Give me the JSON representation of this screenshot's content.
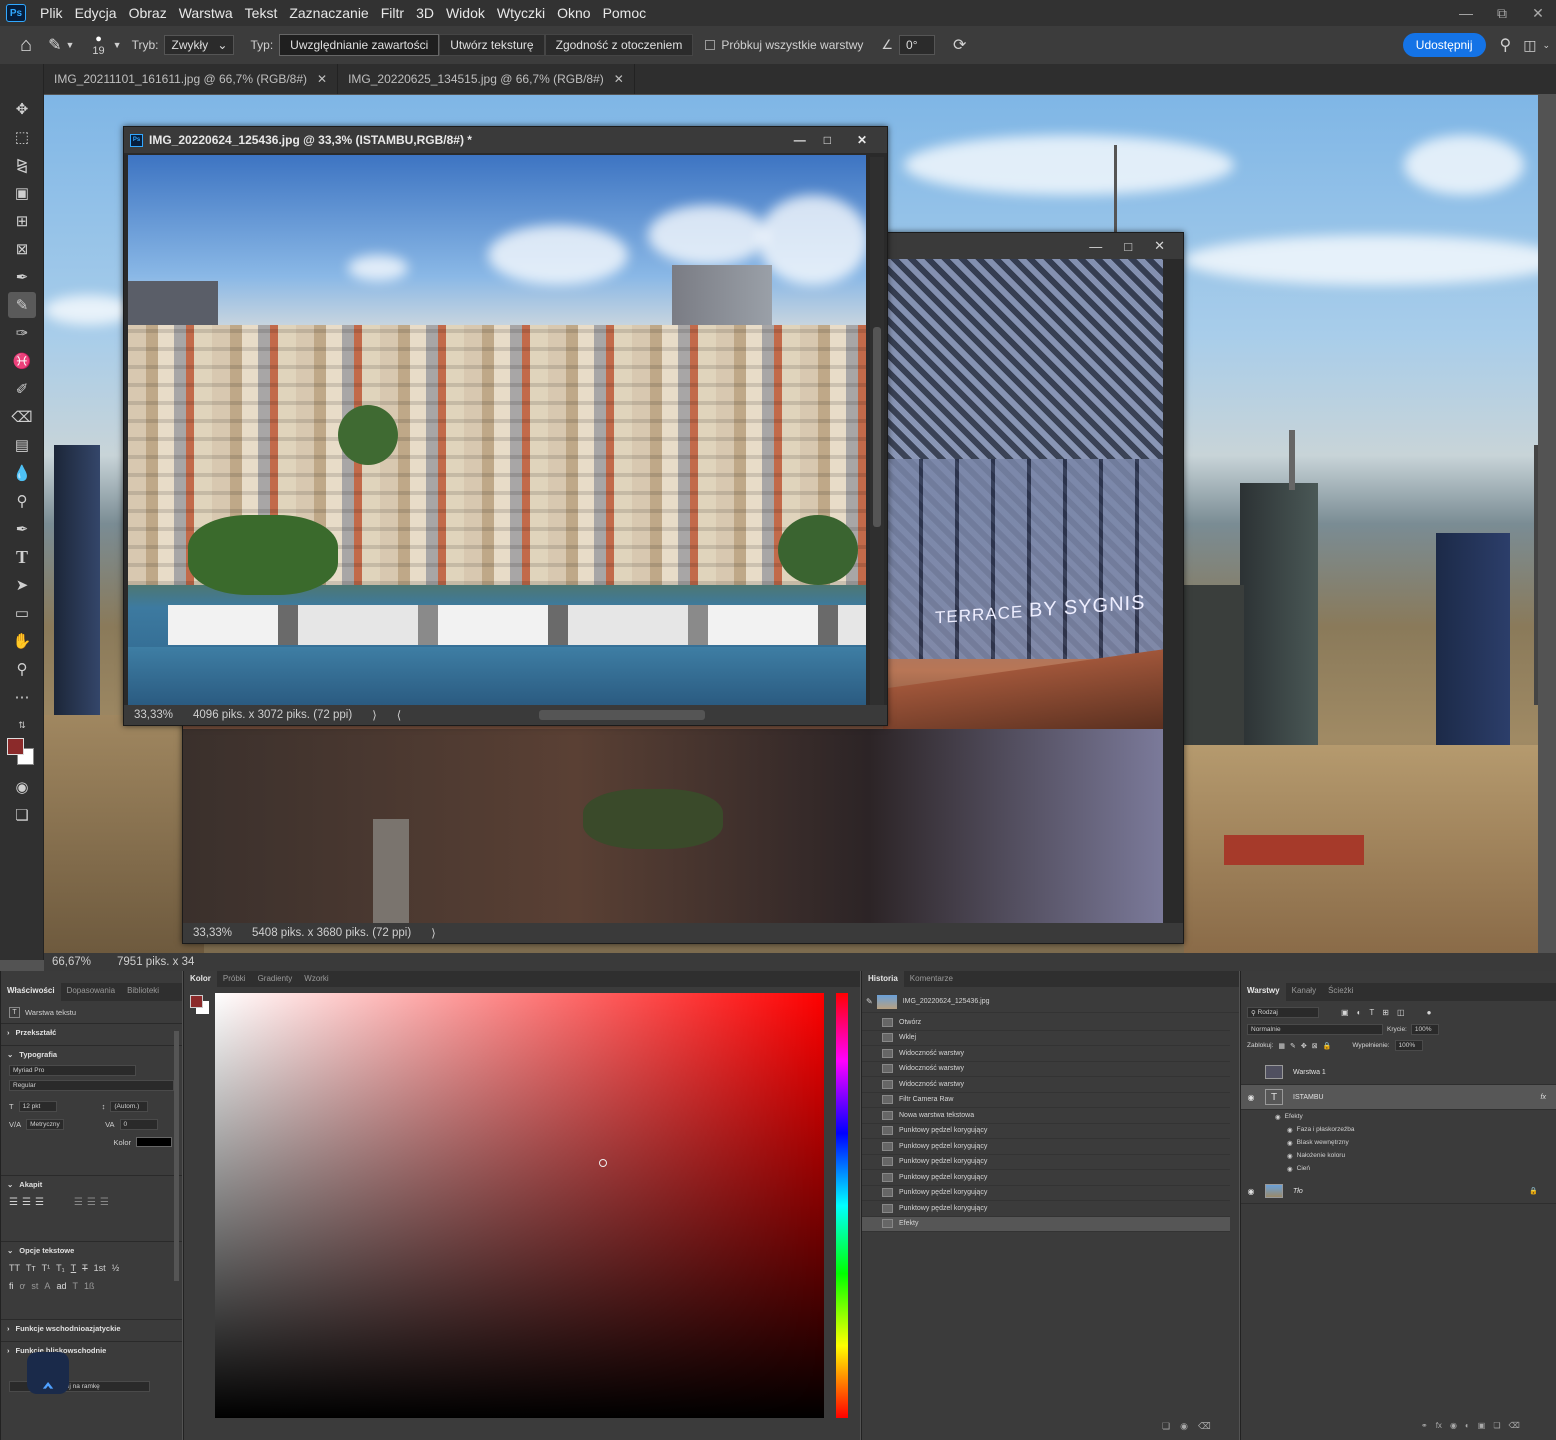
{
  "menubar": {
    "logo": "Ps",
    "items": [
      "Plik",
      "Edycja",
      "Obraz",
      "Warstwa",
      "Tekst",
      "Zaznaczanie",
      "Filtr",
      "3D",
      "Widok",
      "Wtyczki",
      "Okno",
      "Pomoc"
    ]
  },
  "options": {
    "brush_size": "19",
    "mode_label": "Tryb:",
    "mode_value": "Zwykły",
    "type_label": "Typ:",
    "type_buttons": [
      "Uwzględnianie zawartości",
      "Utwórz teksturę",
      "Zgodność z otoczeniem"
    ],
    "sample_all": "Próbkuj wszystkie warstwy",
    "angle": "0°",
    "share": "Udostępnij"
  },
  "tabs": [
    {
      "label": "IMG_20211101_161611.jpg @ 66,7% (RGB/8#)"
    },
    {
      "label": "IMG_20220625_134515.jpg @ 66,7% (RGB/8#)"
    }
  ],
  "windows": {
    "istanbul": {
      "title": "IMG_20220624_125436.jpg @ 33,3% (ISTAMBU,RGB/8#) *",
      "zoom": "33,33%",
      "size": "4096 piks. x 3072 piks. (72 ppi)"
    },
    "interior": {
      "zoom": "33,33%",
      "size": "5408 piks. x 3680 piks. (72 ppi)",
      "sign1": "TERRACE",
      "sign2": "BY SYGNIS"
    }
  },
  "main_status": {
    "zoom": "66,67%",
    "size": "7951 piks. x 34"
  },
  "properties": {
    "tabs": [
      "Właściwości",
      "Dopasowania",
      "Biblioteki"
    ],
    "layer_kind": "Warstwa tekstu",
    "sections": {
      "transform": "Przekształć",
      "typography": "Typografia",
      "paragraph": "Akapit",
      "text_options": "Opcje tekstowe",
      "east_asian": "Funkcje wschodnioazjatyckie",
      "middle_east": "Funkcje bliskowschodnie"
    },
    "font": "Myriad Pro",
    "style": "Regular",
    "size": "12 pkt",
    "leading": "(Autom.)",
    "kerning": "Metryczny",
    "tracking": "0",
    "color_label": "Kolor",
    "frame_label": "tuj na ramkę"
  },
  "color_panel": {
    "tabs": [
      "Kolor",
      "Próbki",
      "Gradienty",
      "Wzorki"
    ],
    "fg": "#8b2a2a",
    "hue": "#ff0000"
  },
  "history": {
    "tabs": [
      "Historia",
      "Komentarze"
    ],
    "snapshot": "IMG_20220624_125436.jpg",
    "items": [
      "Otwórz",
      "Wklej",
      "Widoczność warstwy",
      "Widoczność warstwy",
      "Widoczność warstwy",
      "Filtr Camera Raw",
      "Nowa warstwa tekstowa",
      "Punktowy pędzel korygujący",
      "Punktowy pędzel korygujący",
      "Punktowy pędzel korygujący",
      "Punktowy pędzel korygujący",
      "Punktowy pędzel korygujący",
      "Punktowy pędzel korygujący",
      "Efekty"
    ]
  },
  "layers": {
    "tabs": [
      "Warstwy",
      "Kanały",
      "Ścieżki"
    ],
    "filter": "Rodzaj",
    "blend": "Normalnie",
    "opacity_label": "Krycie:",
    "opacity": "100%",
    "lock_label": "Zablokuj:",
    "fill_label": "Wypełnienie:",
    "fill": "100%",
    "items": [
      {
        "name": "Warstwa 1"
      },
      {
        "name": "ISTAMBU"
      },
      {
        "name": "Tło"
      }
    ],
    "effects_label": "Efekty",
    "effects": [
      "Faza i płaskorzeźba",
      "Blask wewnętrzny",
      "Nałożenie koloru",
      "Cień"
    ],
    "fx": "fx"
  }
}
